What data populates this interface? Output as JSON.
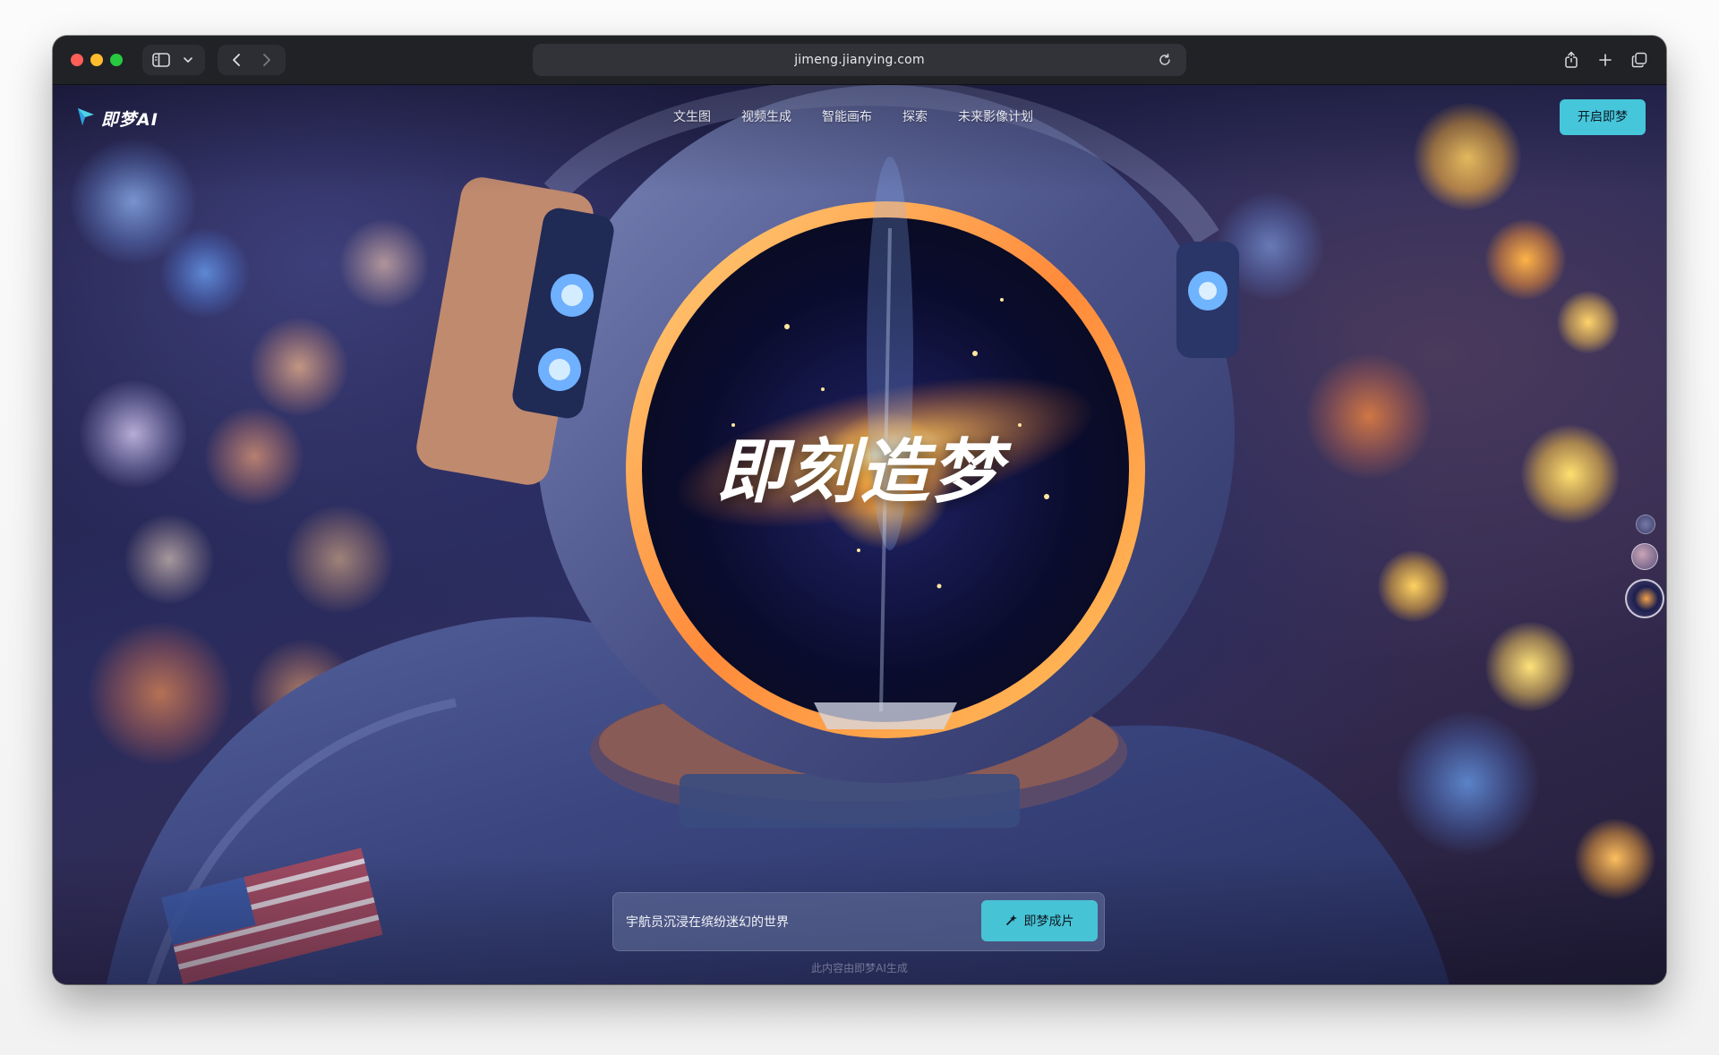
{
  "browser": {
    "url": "jimeng.jianying.com",
    "icons": {
      "sidebar": "sidebar-icon",
      "back": "chevron-left-icon",
      "forward": "chevron-right-icon",
      "reload": "reload-icon",
      "share": "share-icon",
      "new_tab": "plus-icon",
      "tabs": "tabs-overview-icon"
    }
  },
  "site": {
    "brand": "即梦AI",
    "nav": [
      "文生图",
      "视频生成",
      "智能画布",
      "探索",
      "未来影像计划"
    ],
    "cta_top": "开启即梦",
    "headline": "即刻造梦",
    "prompt": {
      "value": "宇航员沉浸在缤纷迷幻的世界",
      "button": "即梦成片"
    },
    "footnote": "此内容由即梦AI生成"
  },
  "colors": {
    "accent": "#46c6da",
    "toolbar": "#202226",
    "traffic_close": "#ff5f57",
    "traffic_minimize": "#febc2e",
    "traffic_zoom": "#28c840"
  }
}
